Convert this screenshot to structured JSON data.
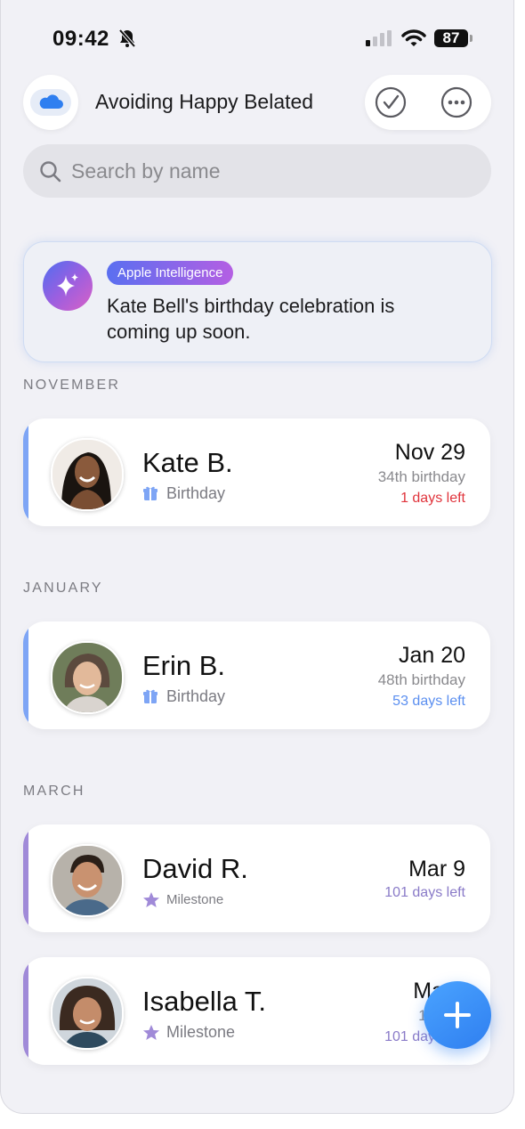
{
  "status_bar": {
    "time": "09:42",
    "battery": "87"
  },
  "header": {
    "title": "Avoiding Happy Belated"
  },
  "search": {
    "placeholder": "Search by name"
  },
  "ai_card": {
    "badge": "Apple Intelligence",
    "message": "Kate Bell's birthday celebration is coming up soon."
  },
  "sections": [
    {
      "title": "NOVEMBER",
      "items": [
        {
          "name": "Kate B.",
          "type": "Birthday",
          "date": "Nov 29",
          "detail": "34th birthday",
          "days_left": "1 days left",
          "accent": "#7ea5f5",
          "days_color": "#e0343c"
        }
      ]
    },
    {
      "title": "JANUARY",
      "items": [
        {
          "name": "Erin B.",
          "type": "Birthday",
          "date": "Jan 20",
          "detail": "48th birthday",
          "days_left": "53 days left",
          "accent": "#7ea5f5",
          "days_color": "#5b8ff0"
        }
      ]
    },
    {
      "title": "MARCH",
      "items": [
        {
          "name": "David R.",
          "type": "Milestone",
          "date": "Mar 9",
          "detail": "",
          "days_left": "101 days left",
          "accent": "#a08ad8",
          "days_color": "#8a7bc8"
        },
        {
          "name": "Isabella T.",
          "type": "Milestone",
          "date": "Ma",
          "detail": "13",
          "days_left": "101 day",
          "accent": "#a08ad8",
          "days_color": "#8a7bc8"
        }
      ]
    }
  ],
  "icons": {
    "bell_muted": "bell-slash-icon",
    "cloud": "cloud-icon",
    "check": "checkmark-circle-icon",
    "more": "ellipsis-circle-icon",
    "search": "search-icon",
    "sparkles": "sparkles-icon",
    "gift": "gift-icon",
    "star": "star-icon",
    "add": "plus-icon"
  },
  "colors": {
    "birthday_accent": "#7ea5f5",
    "milestone_accent": "#a08ad8",
    "urgent": "#e0343c",
    "primary_blue": "#2f7ff0"
  }
}
